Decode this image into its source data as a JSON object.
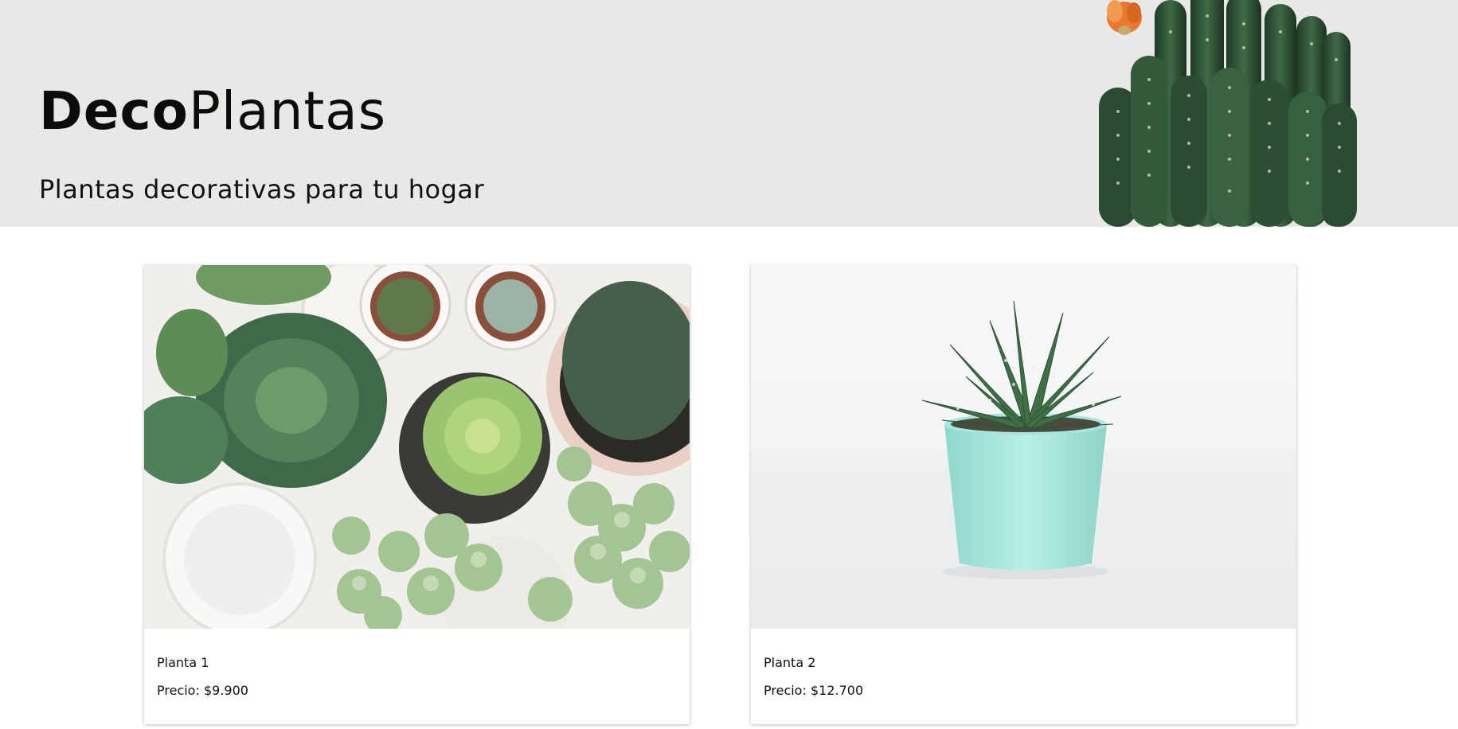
{
  "header": {
    "brand_bold": "Deco",
    "brand_regular": "Plantas",
    "tagline": "Plantas decorativas para tu hogar",
    "background": "#e8e8e6"
  },
  "products": [
    {
      "name": "Planta 1",
      "price_label": "Precio:",
      "price": "$9.900",
      "image": "succulents-overhead-photo"
    },
    {
      "name": "Planta 2",
      "price_label": "Precio:",
      "price": "$12.700",
      "image": "aloe-in-mint-pot-photo"
    }
  ],
  "colors": {
    "cactus_green": "#2f4a33",
    "succulent_green": "#7fae6b",
    "mint_pot": "#a9e6dc",
    "flower_orange": "#e8772f"
  }
}
